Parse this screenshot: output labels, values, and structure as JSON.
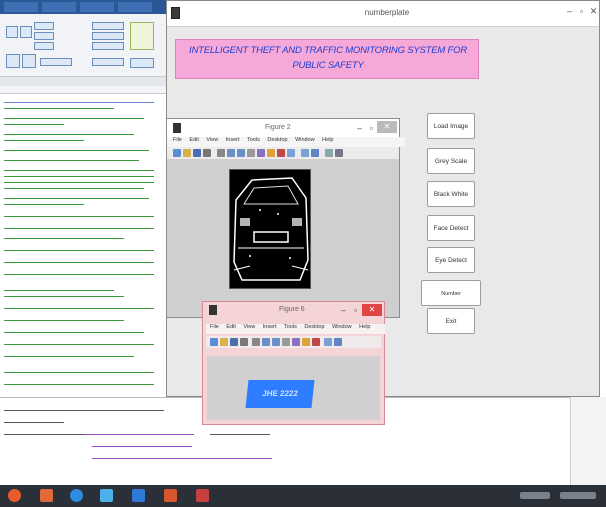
{
  "main_window": {
    "title": "numberplate"
  },
  "banner": {
    "line1": "INTELLIGENT THEFT AND TRAFFIC  MONITORING SYSTEM FOR",
    "line2": "PUBLIC SAFETY"
  },
  "buttons": [
    {
      "label": "Load Image"
    },
    {
      "label": "Grey Scale"
    },
    {
      "label": "Black White"
    },
    {
      "label": "Face Detect"
    },
    {
      "label": "Eye Detect"
    },
    {
      "label": "Number PlateExtraction"
    },
    {
      "label": "Exit"
    }
  ],
  "figure2": {
    "title": "Figure 2",
    "menu": [
      "File",
      "Edit",
      "View",
      "Insert",
      "Tools",
      "Desktop",
      "Window",
      "Help"
    ]
  },
  "figure6": {
    "title": "Figure 6",
    "menu": [
      "File",
      "Edit",
      "View",
      "Insert",
      "Tools",
      "Desktop",
      "Window",
      "Help"
    ],
    "plate_text": "JHE 2222"
  },
  "colors": {
    "banner_bg": "#f6a8d9",
    "banner_text": "#1f3fcf",
    "plate_blue": "#2e7cff",
    "close_red": "#e04343"
  }
}
